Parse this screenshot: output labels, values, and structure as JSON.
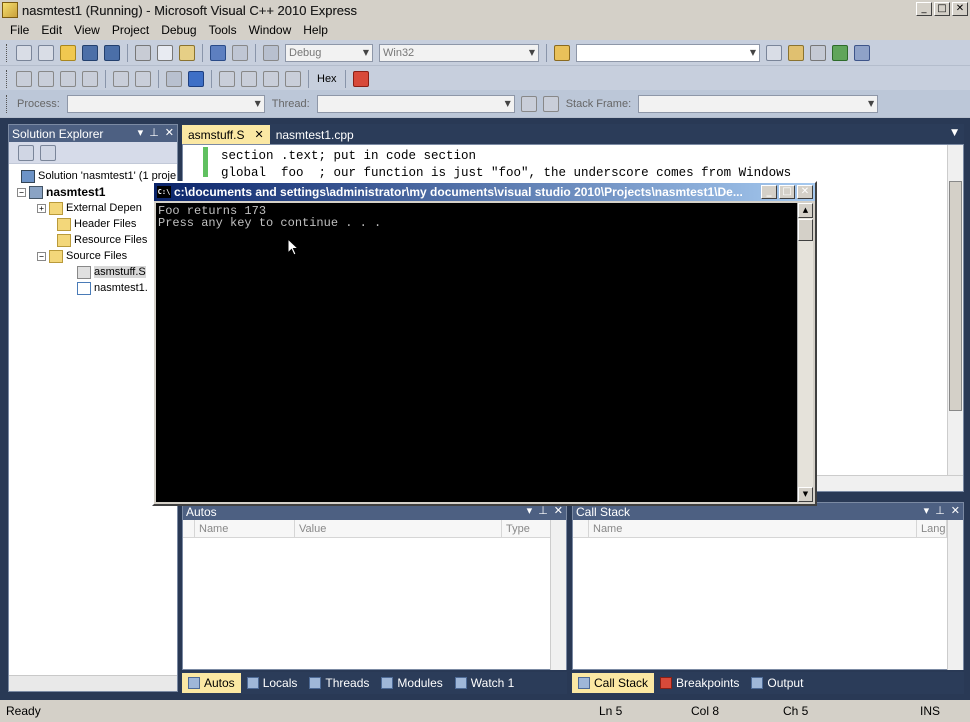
{
  "window": {
    "title": "nasmtest1 (Running) - Microsoft Visual C++ 2010 Express"
  },
  "menu": [
    "File",
    "Edit",
    "View",
    "Project",
    "Debug",
    "Tools",
    "Window",
    "Help"
  ],
  "toolbar": {
    "config": "Debug",
    "platform": "Win32",
    "find": "",
    "hex_label": "Hex",
    "process_label": "Process:",
    "thread_label": "Thread:",
    "stackframe_label": "Stack Frame:"
  },
  "solution_explorer": {
    "title": "Solution Explorer",
    "items": [
      {
        "label": "Solution 'nasmtest1' (1 proje",
        "icon": "solution-icon"
      },
      {
        "label": "nasmtest1",
        "icon": "project-icon"
      },
      {
        "label": "External Depen",
        "icon": "folder-icon"
      },
      {
        "label": "Header Files",
        "icon": "folder-icon"
      },
      {
        "label": "Resource Files",
        "icon": "folder-icon"
      },
      {
        "label": "Source Files",
        "icon": "folder-icon"
      },
      {
        "label": "asmstuff.S",
        "icon": "asm-file-icon"
      },
      {
        "label": "nasmtest1.",
        "icon": "cpp-file-icon"
      }
    ]
  },
  "editor": {
    "tabs": [
      {
        "label": "asmstuff.S"
      },
      {
        "label": "nasmtest1.cpp"
      }
    ],
    "lines": [
      "section .text; put in code section",
      "global  foo  ; our function is just \"foo\", the underscore comes from Windows"
    ]
  },
  "console": {
    "title": "c:\\documents and settings\\administrator\\my documents\\visual studio 2010\\Projects\\nasmtest1\\De...",
    "lines": [
      "Foo returns 173",
      "Press any key to continue . . ."
    ]
  },
  "autos": {
    "title": "Autos",
    "columns": [
      "Name",
      "Value",
      "Type"
    ]
  },
  "callstack": {
    "title": "Call Stack",
    "columns": [
      "Name",
      "Lang"
    ]
  },
  "bottom_tabs_left": [
    "Autos",
    "Locals",
    "Threads",
    "Modules",
    "Watch 1"
  ],
  "bottom_tabs_right": [
    "Call Stack",
    "Breakpoints",
    "Output"
  ],
  "status": {
    "text": "Ready",
    "ln": "Ln 5",
    "col": "Col 8",
    "ch": "Ch 5",
    "ins": "INS"
  }
}
